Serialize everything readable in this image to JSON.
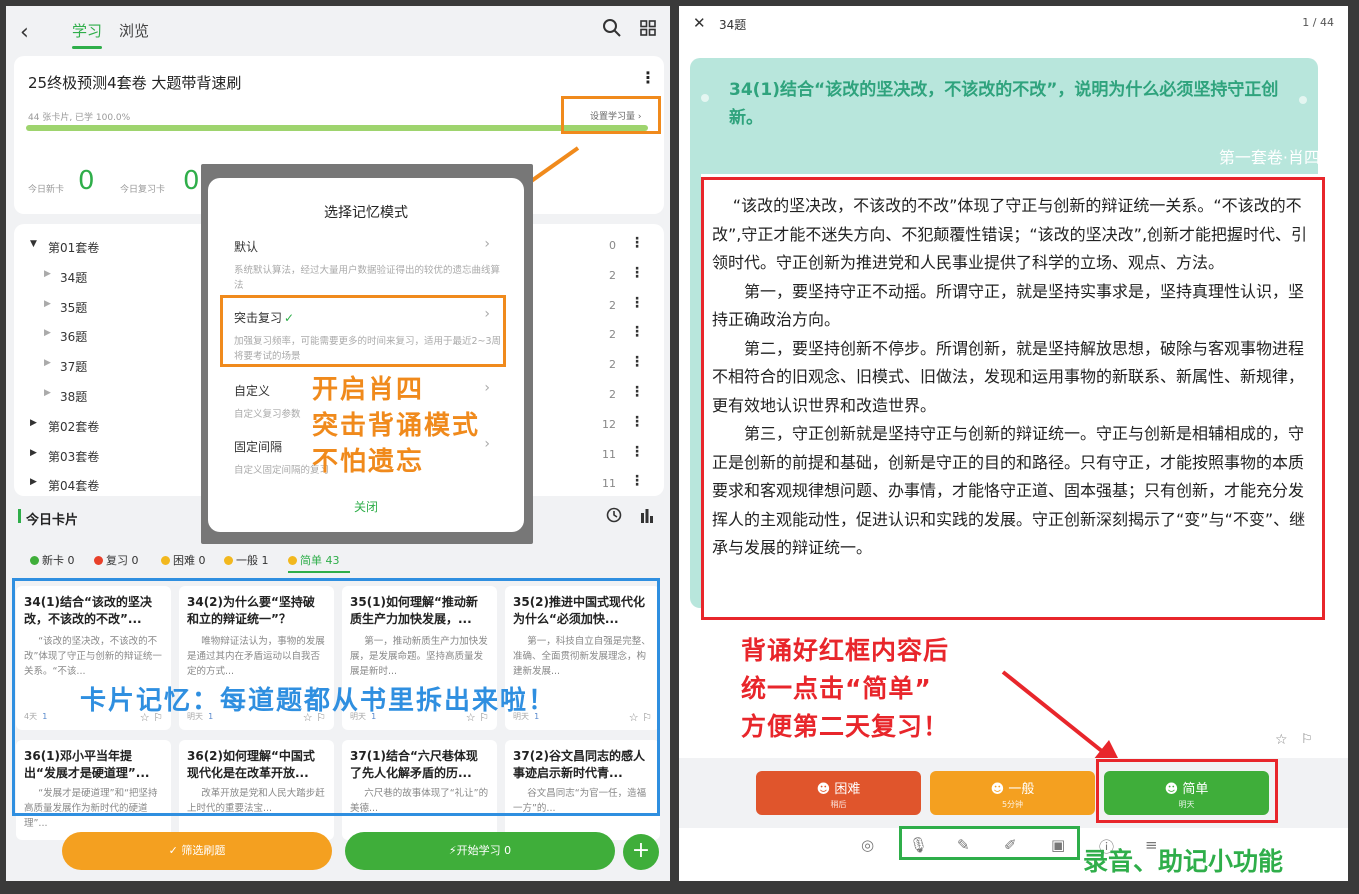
{
  "left": {
    "tabs": [
      "学习",
      "浏览"
    ],
    "deck": {
      "title": "25终极预测4套卷 大题带背速刷",
      "progress_text": "44 张卡片, 已学 100.0%",
      "progress_fraction": 1.0,
      "set_goal": "设置学习量 ›",
      "new_today_label": "今日新卡",
      "new_today_value": "0",
      "review_today_label": "今日复习卡",
      "review_today_value": "0"
    },
    "tree": [
      {
        "label": "第01套卷",
        "count": "0",
        "expanded": true,
        "level": 0
      },
      {
        "label": "34题",
        "count": "2",
        "level": 1
      },
      {
        "label": "35题",
        "count": "2",
        "level": 1
      },
      {
        "label": "36题",
        "count": "2",
        "level": 1
      },
      {
        "label": "37题",
        "count": "2",
        "level": 1
      },
      {
        "label": "38题",
        "count": "2",
        "level": 1
      },
      {
        "label": "第02套卷",
        "count": "12",
        "level": 0
      },
      {
        "label": "第03套卷",
        "count": "11",
        "level": 0
      },
      {
        "label": "第04套卷",
        "count": "11",
        "level": 0
      }
    ],
    "today_cards_title": "今日卡片",
    "stats": {
      "new": "新卡 0",
      "review": "复习 0",
      "hard": "困难 0",
      "normal": "一般 1",
      "easy": "简单 43"
    },
    "cards": [
      {
        "title": "34(1)结合“该改的坚决改，不该改的不改”...",
        "body": "“该改的坚决改，不该改的不改”体现了守正与创新的辩证统一关系。“不该...",
        "due": "4天",
        "count": "1"
      },
      {
        "title": "34(2)为什么要“坚持破和立的辩证统一”？",
        "body": "唯物辩证法认为，事物的发展是通过其内在矛盾运动以自我否定的方式...",
        "due": "明天",
        "count": "1"
      },
      {
        "title": "35(1)如何理解“推动新质生产力加快发展，...",
        "body": "第一，推动新质生产力加快发展，是发展命题。坚持高质量发展是新时...",
        "due": "明天",
        "count": "1"
      },
      {
        "title": "35(2)推进中国式现代化为什么“必须加快...",
        "body": "第一，科技自立自强是完整、准确、全面贯彻新发展理念，构建新发展...",
        "due": "明天",
        "count": "1"
      }
    ],
    "cards2": [
      {
        "title": "36(1)邓小平当年提出“发展才是硬道理”...",
        "body": "“发展才是硬道理”和“把坚持高质量发展作为新时代的硬道理”..."
      },
      {
        "title": "36(2)如何理解“中国式现代化是在改革开放...",
        "body": "改革开放是党和人民大踏步赶上时代的重要法宝..."
      },
      {
        "title": "37(1)结合“六尺巷体现了先人化解矛盾的历...",
        "body": "六尺巷的故事体现了“礼让”的美德..."
      },
      {
        "title": "37(2)谷文昌同志的感人事迹启示新时代青...",
        "body": "谷文昌同志“为官一任，造福一方”的..."
      }
    ],
    "filter_btn": "✓ 筛选刷题",
    "start_btn": "⚡开始学习 0",
    "fab": "+",
    "modal": {
      "title": "选择记忆模式",
      "options": [
        {
          "name": "默认",
          "desc": "系统默认算法，经过大量用户数据验证得出的较优的遗忘曲线算法"
        },
        {
          "name": "突击复习",
          "check": "✓",
          "desc": "加强复习频率，可能需要更多的时间来复习，适用于最近2~3周将要考试的场景"
        },
        {
          "name": "自定义",
          "desc": "自定义复习参数"
        },
        {
          "name": "固定间隔",
          "desc": "自定义固定间隔的复习"
        }
      ],
      "close": "关闭"
    },
    "annotation_orange": [
      "开启肖四",
      "突击背诵模式",
      "不怕遗忘"
    ],
    "annotation_blue": "卡片记忆：每道题都从书里拆出来啦！"
  },
  "right": {
    "header_title": "34题",
    "page": "1 / 44",
    "question": "34(1)结合“该改的坚决改，不该改的不改”，说明为什么必须坚持守正创新。",
    "source": "第一套卷·肖四",
    "answer": [
      "“该改的坚决改，不该改的不改”体现了守正与创新的辩证统一关系。“不该改的不改”,守正才能不迷失方向、不犯颠覆性错误；“该改的坚决改”,创新才能把握时代、引领时代。守正创新为推进党和人民事业提供了科学的立场、观点、方法。",
      "第一，要坚持守正不动摇。所谓守正，就是坚持实事求是，坚持真理性认识，坚持正确政治方向。",
      "第二，要坚持创新不停步。所谓创新，就是坚持解放思想，破除与客观事物进程不相符合的旧观念、旧模式、旧做法，发现和运用事物的新联系、新属性、新规律，更有效地认识世界和改造世界。",
      "第三，守正创新就是坚持守正与创新的辩证统一。守正与创新是相辅相成的，守正是创新的前提和基础，创新是守正的目的和路径。只有守正，才能按照事物的本质要求和客观规律想问题、办事情，才能恪守正道、固本强基；只有创新，才能充分发挥人的主观能动性，促进认识和实践的发展。守正创新深刻揭示了“变”与“不变”、继承与发展的辩证统一。"
    ],
    "annotation_red": [
      "背诵好红框内容后",
      "统一点击“简单”",
      "方便第二天复习！"
    ],
    "buttons": [
      {
        "label": "困难",
        "sub": "稍后",
        "color": "#e0552c"
      },
      {
        "label": "一般",
        "sub": "5分钟",
        "color": "#f4a020"
      },
      {
        "label": "简单",
        "sub": "明天",
        "color": "#3fae3a"
      }
    ],
    "annotation_green": "录音、助记小功能"
  }
}
